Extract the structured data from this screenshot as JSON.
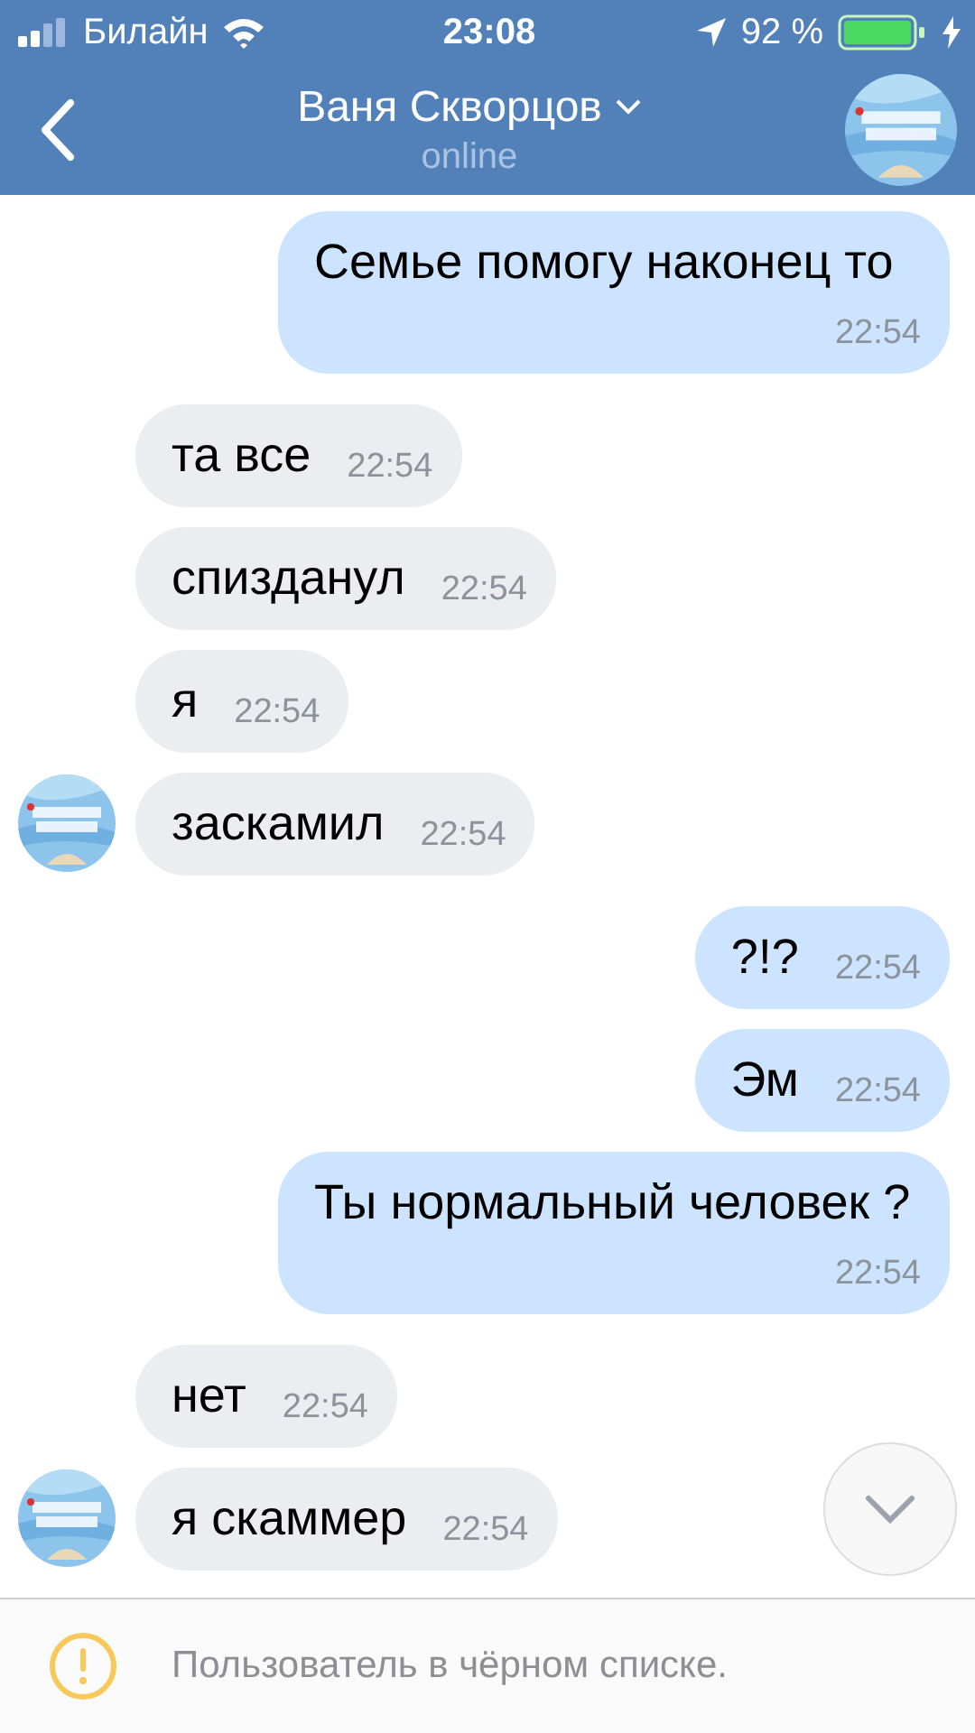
{
  "status_bar": {
    "carrier": "Билайн",
    "time": "23:08",
    "battery": "92 %"
  },
  "header": {
    "title": "Ваня Скворцов",
    "status": "online"
  },
  "messages": [
    {
      "kind": "outgoing",
      "text": "Семье помогу наконец то",
      "time": "22:54"
    },
    {
      "kind": "incoming",
      "text": "та все",
      "time": "22:54"
    },
    {
      "kind": "incoming",
      "text": "спизданул",
      "time": "22:54"
    },
    {
      "kind": "incoming",
      "text": "я",
      "time": "22:54"
    },
    {
      "kind": "incoming",
      "text": "заскамил",
      "time": "22:54"
    },
    {
      "kind": "outgoing",
      "text": "?!?",
      "time": "22:54"
    },
    {
      "kind": "outgoing",
      "text": "Эм",
      "time": "22:54"
    },
    {
      "kind": "outgoing",
      "text": "Ты нормальный человек ?",
      "time": "22:54"
    },
    {
      "kind": "incoming",
      "text": "нет",
      "time": "22:54"
    },
    {
      "kind": "incoming",
      "text": "я скаммер",
      "time": "22:54"
    }
  ],
  "notice": {
    "text": "Пользователь в чёрном списке."
  }
}
